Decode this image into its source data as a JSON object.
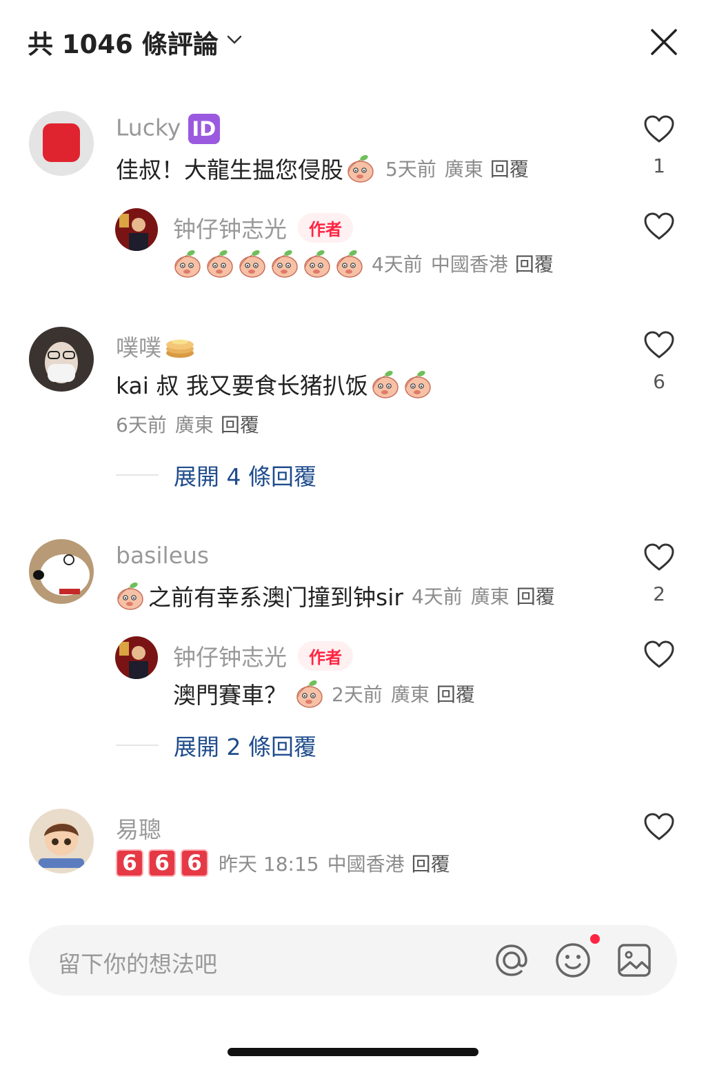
{
  "header": {
    "title": "共 1046 條評論",
    "icons": {
      "chevron": "chevron-down-icon",
      "close": "close-icon"
    }
  },
  "comments": [
    {
      "user": "Lucky",
      "badge": "ID",
      "text": "佳叔！大龍生揾您侵股",
      "time": "5天前",
      "location": "廣東",
      "reply": "回覆",
      "likes": "1",
      "replies": [
        {
          "user": "钟仔钟志光",
          "tag": "作者",
          "emoji_count": 6,
          "time": "4天前",
          "location": "中國香港",
          "reply": "回覆"
        }
      ]
    },
    {
      "user": "噗噗",
      "text": "kai 叔 我又要食长猪扒饭",
      "time": "6天前",
      "location": "廣東",
      "reply": "回覆",
      "likes": "6",
      "expand": "展開 4 條回覆"
    },
    {
      "user": "basileus",
      "text": "之前有幸系澳门撞到钟sir",
      "time": "4天前",
      "location": "廣東",
      "reply": "回覆",
      "likes": "2",
      "replies": [
        {
          "user": "钟仔钟志光",
          "tag": "作者",
          "text": "澳門賽車？",
          "time": "2天前",
          "location": "廣東",
          "reply": "回覆"
        }
      ],
      "expand": "展開 2 條回覆"
    },
    {
      "user": "易聰",
      "digits": [
        "6",
        "6",
        "6"
      ],
      "time": "昨天 18:15",
      "location": "中國香港",
      "reply": "回覆"
    }
  ],
  "input": {
    "placeholder": "留下你的想法吧",
    "icons": [
      "at-icon",
      "emoji-icon",
      "image-icon"
    ]
  },
  "colors": {
    "accent": "#ff2442",
    "link": "#1f4c8c",
    "meta": "#8c8c8c"
  }
}
